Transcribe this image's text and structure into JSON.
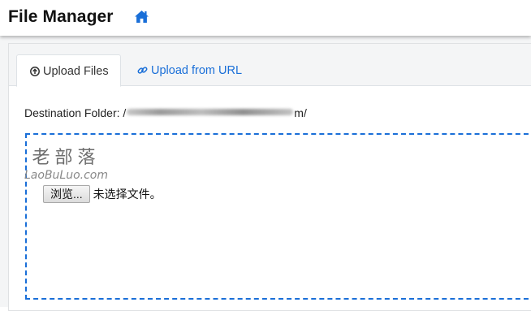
{
  "header": {
    "title": "File Manager",
    "home_icon": "home-icon"
  },
  "tabs": [
    {
      "label": "Upload Files",
      "icon": "arrow-circle-up-icon",
      "active": true
    },
    {
      "label": "Upload from URL",
      "icon": "link-icon",
      "active": false
    }
  ],
  "destination": {
    "label": "Destination Folder: /",
    "suffix": "m/"
  },
  "upload": {
    "browse_label": "浏览...",
    "no_file_text": "未选择文件。"
  },
  "watermark": {
    "cn": "老部落",
    "en": "LaoBuLuo.com"
  },
  "colors": {
    "accent": "#1a6fd8",
    "dropzone_border": "#1a6fd8"
  }
}
